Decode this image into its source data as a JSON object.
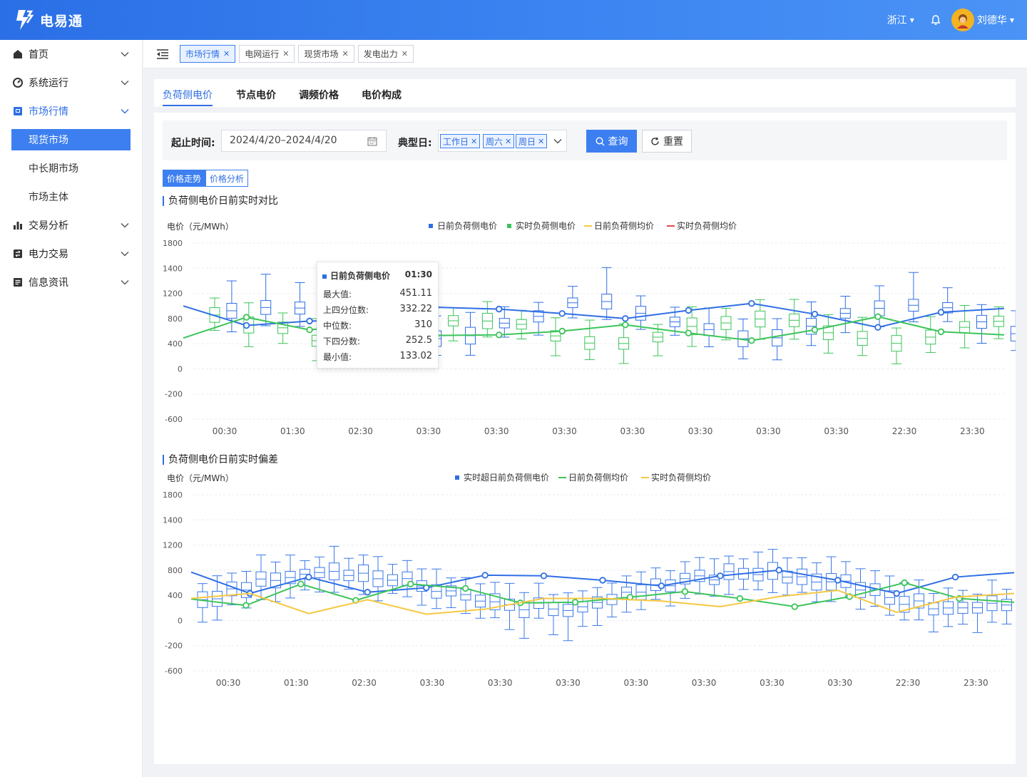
{
  "app": {
    "name": "电易通"
  },
  "topbar": {
    "region": "浙江",
    "user": "刘德华"
  },
  "sidebar": {
    "items": [
      {
        "label": "首页",
        "icon": "home-icon"
      },
      {
        "label": "系统运行",
        "icon": "gauge-icon"
      },
      {
        "label": "市场行情",
        "icon": "market-icon",
        "open": true,
        "children": [
          "现货市场",
          "中长期市场",
          "市场主体"
        ],
        "selected": "现货市场"
      },
      {
        "label": "交易分析",
        "icon": "bar-chart-icon"
      },
      {
        "label": "电力交易",
        "icon": "trade-icon"
      },
      {
        "label": "信息资讯",
        "icon": "news-icon"
      }
    ]
  },
  "page_tags": [
    {
      "label": "市场行情",
      "selected": true
    },
    {
      "label": "电网运行",
      "selected": false
    },
    {
      "label": "现货市场",
      "selected": false
    },
    {
      "label": "发电出力",
      "selected": false
    }
  ],
  "page_tabs": [
    "负荷侧电价",
    "节点电价",
    "调频价格",
    "电价构成"
  ],
  "filter": {
    "date_label": "起止时间:",
    "date_value": "2024/4/20–2024/4/20",
    "day_label": "典型日:",
    "day_chips": [
      "工作日",
      "周六",
      "周日"
    ],
    "query_label": "查询",
    "reset_label": "重置"
  },
  "view_toggle": [
    "价格走势",
    "价格分析"
  ],
  "colors": {
    "accent": "#3d7ff0",
    "blue": "#2f6fe4",
    "green": "#3cc45a",
    "yellow": "#f5c842",
    "red": "#e5484d"
  },
  "tooltip": {
    "series": "日前负荷侧电价",
    "time": "01:30",
    "rows": [
      {
        "label": "最大值:",
        "value": "451.11"
      },
      {
        "label": "上四分位数:",
        "value": "332.22"
      },
      {
        "label": "中位数:",
        "value": "310"
      },
      {
        "label": "下四分数:",
        "value": "252.5"
      },
      {
        "label": "最小值:",
        "value": "133.02"
      }
    ]
  },
  "chart_data": [
    {
      "title": "负荷侧电价日前实时对比",
      "type": "line",
      "ylabel": "电价（元/MWh）",
      "yticks": [
        "1800",
        "1400",
        "1200",
        "800",
        "400",
        "0",
        "-200",
        "-600"
      ],
      "ylim": [
        -600,
        1800
      ],
      "x": [
        "00:30",
        "01:30",
        "02:30",
        "03:30",
        "03:30",
        "03:30",
        "03:30",
        "03:30",
        "03:30",
        "03:30",
        "22:30",
        "23:30"
      ],
      "legend": [
        "日前负荷侧电价",
        "实时负荷侧电价",
        "日前负荷侧均价",
        "实时负荷侧均价"
      ],
      "grid": true,
      "series": [
        {
          "name": "日前负荷侧电价",
          "style": "boxplot+line",
          "line": [
            1000,
            690,
            760,
            770,
            980,
            950,
            880,
            800,
            930,
            1040,
            870,
            660,
            900,
            960
          ]
        },
        {
          "name": "实时负荷侧电价",
          "style": "boxplot+line",
          "line": [
            490,
            820,
            620,
            720,
            530,
            540,
            600,
            700,
            570,
            450,
            620,
            830,
            590,
            540
          ]
        }
      ]
    },
    {
      "title": "负荷侧电价日前实时偏差",
      "type": "line",
      "ylabel": "电价（元/MWh）",
      "yticks": [
        "1800",
        "1400",
        "1200",
        "800",
        "400",
        "0",
        "-200",
        "-600"
      ],
      "ylim": [
        -600,
        1800
      ],
      "x": [
        "00:30",
        "01:30",
        "02:30",
        "03:30",
        "03:30",
        "03:30",
        "03:30",
        "03:30",
        "03:30",
        "03:30",
        "22:30",
        "23:30"
      ],
      "legend": [
        "实时超日前负荷侧电价",
        "日前负荷侧均价",
        "实时负荷侧均价"
      ],
      "grid": true,
      "series": [
        {
          "name": "实时超日前负荷侧电价",
          "style": "boxplot+line",
          "line": [
            770,
            430,
            690,
            450,
            520,
            720,
            710,
            640,
            550,
            710,
            800,
            640,
            430,
            690,
            760
          ]
        },
        {
          "name": "日前负荷侧均价",
          "style": "line",
          "line": [
            340,
            240,
            580,
            320,
            580,
            510,
            280,
            290,
            370,
            460,
            350,
            220,
            380,
            600,
            350,
            290
          ]
        },
        {
          "name": "实时负荷侧均价",
          "style": "line",
          "line": [
            350,
            430,
            110,
            330,
            100,
            180,
            350,
            350,
            310,
            220,
            380,
            480,
            130,
            370,
            430
          ]
        }
      ]
    }
  ]
}
